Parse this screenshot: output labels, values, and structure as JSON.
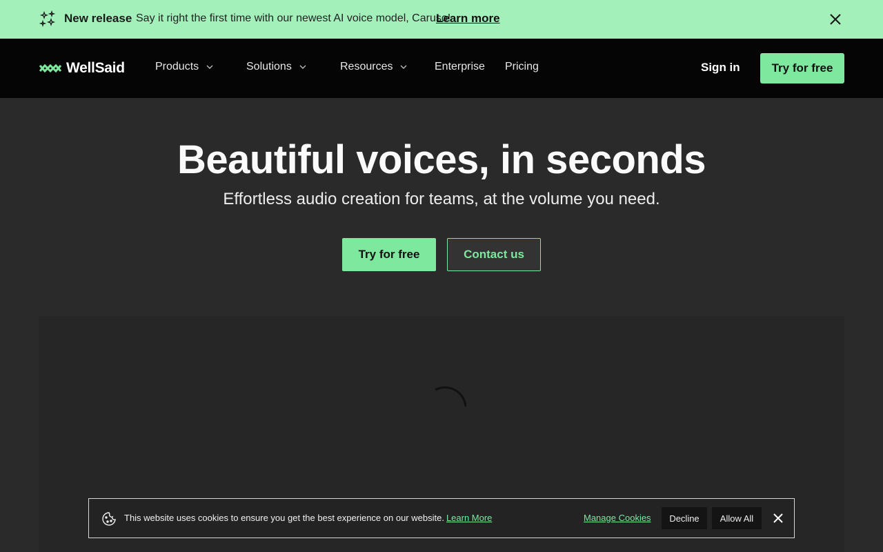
{
  "announcement": {
    "tag": "New release",
    "message": "Say it right the first time with our newest AI voice model, Caruso!",
    "link": "Learn more",
    "icon": "sparkle-icon",
    "close_icon": "close-icon"
  },
  "nav": {
    "brand": "WellSaid",
    "items": [
      {
        "label": "Products",
        "has_dropdown": true
      },
      {
        "label": "Solutions",
        "has_dropdown": true
      },
      {
        "label": "Resources",
        "has_dropdown": true
      },
      {
        "label": "Enterprise",
        "has_dropdown": false
      },
      {
        "label": "Pricing",
        "has_dropdown": false
      }
    ],
    "sign_in": "Sign in",
    "cta": "Try for free"
  },
  "hero": {
    "title": "Beautiful voices, in seconds",
    "subtitle": "Effortless audio creation for teams, at the volume you need.",
    "primary_cta": "Try for free",
    "secondary_cta": "Contact us"
  },
  "cookie": {
    "text": "This website uses cookies to ensure you get the best experience on our website.",
    "learn_more": "Learn More",
    "manage": "Manage Cookies",
    "decline": "Decline",
    "allow": "Allow All",
    "icon": "cookie-icon",
    "close_icon": "close-icon"
  },
  "colors": {
    "accent": "#7ee89f",
    "announce_bg": "#a3f0bb",
    "nav_bg": "#050505",
    "hero_bg": "#2a2a2a"
  }
}
